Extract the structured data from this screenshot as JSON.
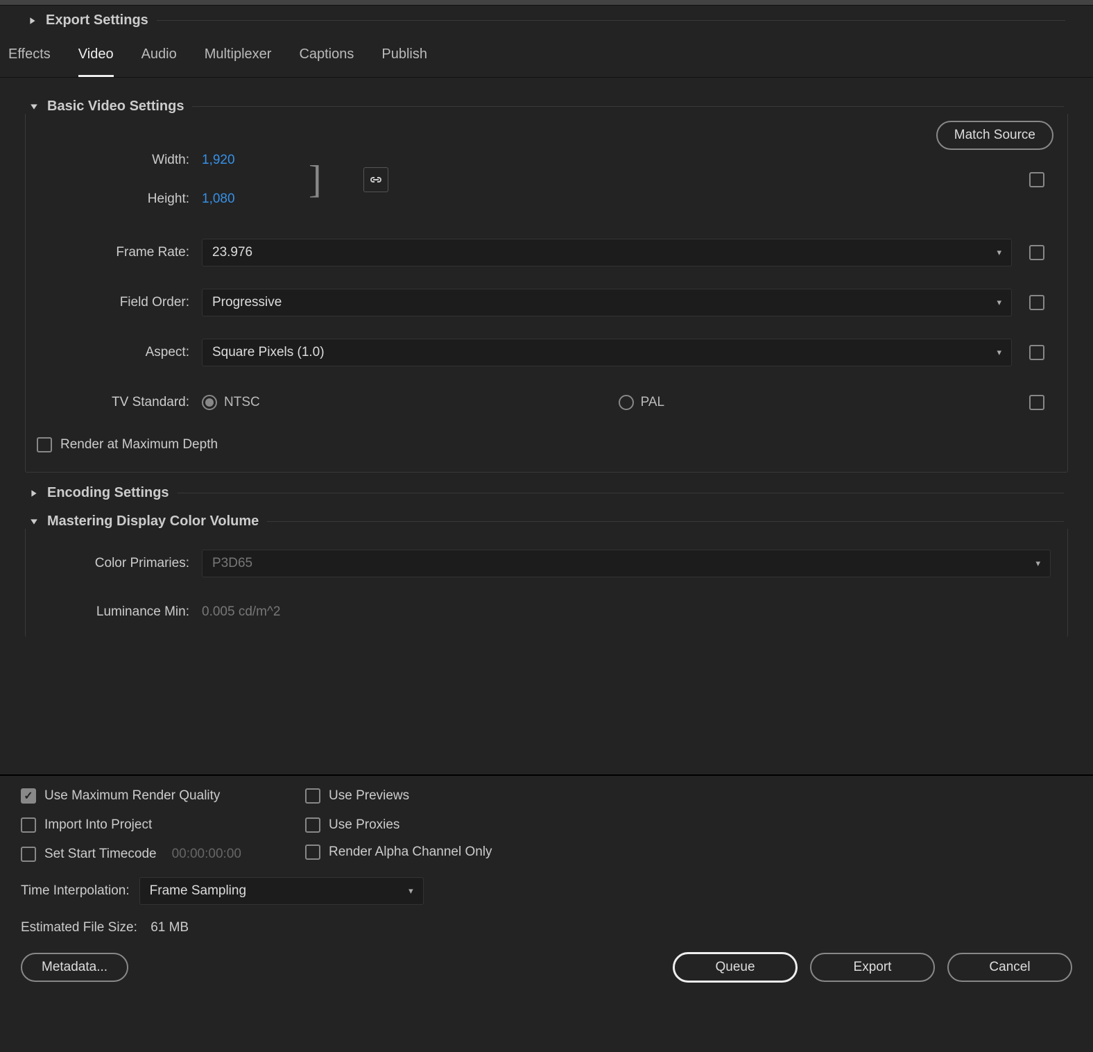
{
  "export_settings": {
    "title": "Export Settings"
  },
  "tabs": [
    "Effects",
    "Video",
    "Audio",
    "Multiplexer",
    "Captions",
    "Publish"
  ],
  "active_tab": "Video",
  "basic": {
    "title": "Basic Video Settings",
    "match_source": "Match Source",
    "width_label": "Width:",
    "width": "1,920",
    "height_label": "Height:",
    "height": "1,080",
    "frame_rate_label": "Frame Rate:",
    "frame_rate": "23.976",
    "field_order_label": "Field Order:",
    "field_order": "Progressive",
    "aspect_label": "Aspect:",
    "aspect": "Square Pixels (1.0)",
    "tv_label": "TV Standard:",
    "ntsc": "NTSC",
    "pal": "PAL",
    "render_max_depth": "Render at Maximum Depth"
  },
  "encoding": {
    "title": "Encoding Settings"
  },
  "mastering": {
    "title": "Mastering Display Color Volume",
    "color_primaries_label": "Color Primaries:",
    "color_primaries": "P3D65",
    "lum_min_label": "Luminance Min:",
    "lum_min": "0.005 cd/m^2"
  },
  "options": {
    "use_max_quality": "Use Maximum Render Quality",
    "use_previews": "Use Previews",
    "import_project": "Import Into Project",
    "use_proxies": "Use Proxies",
    "set_start_tc": "Set Start Timecode",
    "start_tc": "00:00:00:00",
    "render_alpha": "Render Alpha Channel Only"
  },
  "time_interp": {
    "label": "Time Interpolation:",
    "value": "Frame Sampling"
  },
  "estimate": {
    "label": "Estimated File Size:",
    "value": "61 MB"
  },
  "buttons": {
    "metadata": "Metadata...",
    "queue": "Queue",
    "export": "Export",
    "cancel": "Cancel"
  }
}
